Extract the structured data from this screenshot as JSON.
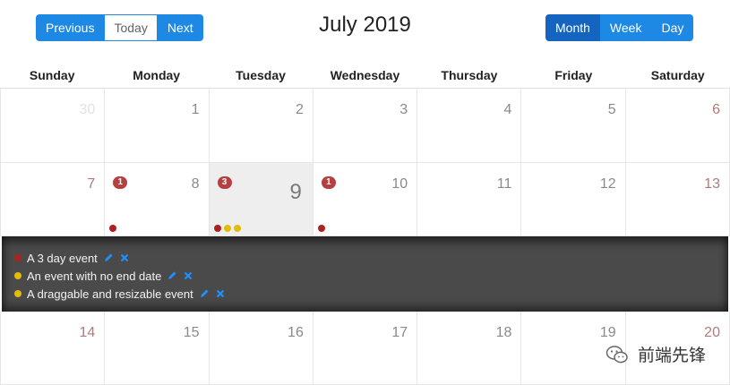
{
  "toolbar": {
    "previous_label": "Previous",
    "today_label": "Today",
    "next_label": "Next",
    "title": "July 2019",
    "month_label": "Month",
    "week_label": "Week",
    "day_label": "Day",
    "active_view": "Month"
  },
  "weekdays": [
    "Sunday",
    "Monday",
    "Tuesday",
    "Wednesday",
    "Thursday",
    "Friday",
    "Saturday"
  ],
  "weeks": [
    [
      {
        "day": "30",
        "outside_month": true,
        "weekend": true
      },
      {
        "day": "1"
      },
      {
        "day": "2"
      },
      {
        "day": "3"
      },
      {
        "day": "4"
      },
      {
        "day": "5"
      },
      {
        "day": "6",
        "weekend": true
      }
    ],
    [
      {
        "day": "7",
        "weekend": true
      },
      {
        "day": "8",
        "badge": "1",
        "dots": [
          "#ad2121"
        ]
      },
      {
        "day": "9",
        "badge": "3",
        "today": true,
        "dots": [
          "#ad2121",
          "#e3bc08",
          "#e3bc08"
        ]
      },
      {
        "day": "10",
        "badge": "1",
        "dots": [
          "#ad2121"
        ]
      },
      {
        "day": "11"
      },
      {
        "day": "12"
      },
      {
        "day": "13",
        "weekend": true
      }
    ],
    [
      {
        "day": "14",
        "weekend": true
      },
      {
        "day": "15"
      },
      {
        "day": "16"
      },
      {
        "day": "17"
      },
      {
        "day": "18"
      },
      {
        "day": "19"
      },
      {
        "day": "20",
        "weekend": true
      }
    ]
  ],
  "open_day_events": [
    {
      "title": "A 3 day event",
      "color": "#ad2121"
    },
    {
      "title": "An event with no end date",
      "color": "#e3bc08"
    },
    {
      "title": "A draggable and resizable event",
      "color": "#e3bc08"
    }
  ],
  "event_action_icons": [
    "pencil-icon",
    "close-icon"
  ],
  "colors": {
    "primary": "#1e88e5",
    "primary_active": "#1565c0",
    "badge": "#b5403f",
    "panel_bg": "#4a4a4a",
    "action_icon": "#1e90ff"
  },
  "watermark": {
    "text": "前端先锋",
    "icon": "wechat-icon"
  }
}
